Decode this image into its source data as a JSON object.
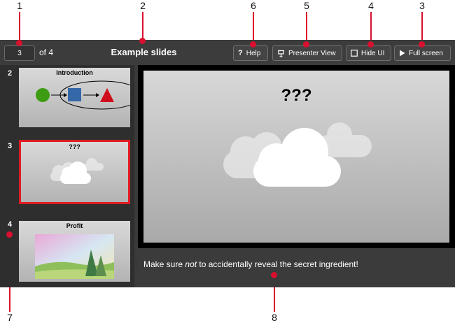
{
  "callouts": [
    "1",
    "2",
    "3",
    "4",
    "5",
    "6",
    "7",
    "8"
  ],
  "toolbar": {
    "page_number": "3",
    "page_of": "of 4",
    "title": "Example slides",
    "help_label": "Help",
    "presenter_label": "Presenter View",
    "hide_ui_label": "Hide UI",
    "fullscreen_label": "Full screen"
  },
  "thumbnails": [
    {
      "number": "2",
      "title": "Introduction"
    },
    {
      "number": "3",
      "title": "???"
    },
    {
      "number": "4",
      "title": "Profit"
    }
  ],
  "slide": {
    "title": "???"
  },
  "notes": {
    "before": "Make sure ",
    "emphasis": "not",
    "after": " to accidentally reveal the secret ingredient!"
  },
  "colors": {
    "accent": "#e01b24",
    "callout": "#d9102e"
  }
}
